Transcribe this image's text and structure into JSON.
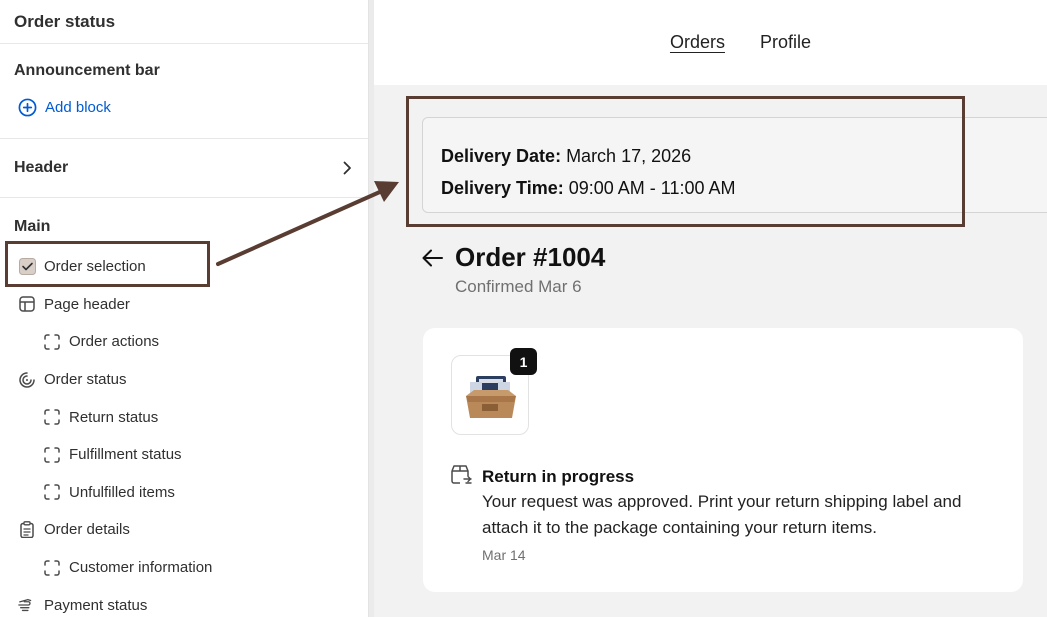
{
  "sidebar": {
    "title": "Order status",
    "announcement": {
      "label": "Announcement bar",
      "add_block": "Add block"
    },
    "header": {
      "label": "Header"
    },
    "main": {
      "label": "Main",
      "items": [
        {
          "label": "Order selection",
          "icon": "checkbox-icon",
          "level": 1
        },
        {
          "label": "Page header",
          "icon": "layout-icon",
          "level": 1
        },
        {
          "label": "Order actions",
          "icon": "block-icon",
          "level": 2
        },
        {
          "label": "Order status",
          "icon": "status-icon",
          "level": 1
        },
        {
          "label": "Return status",
          "icon": "block-icon",
          "level": 2
        },
        {
          "label": "Fulfillment status",
          "icon": "block-icon",
          "level": 2
        },
        {
          "label": "Unfulfilled items",
          "icon": "block-icon",
          "level": 2
        },
        {
          "label": "Order details",
          "icon": "clipboard-icon",
          "level": 1
        },
        {
          "label": "Customer information",
          "icon": "block-icon",
          "level": 2
        },
        {
          "label": "Payment status",
          "icon": "payment-icon",
          "level": 1
        }
      ]
    }
  },
  "preview": {
    "nav": {
      "orders": "Orders",
      "profile": "Profile"
    },
    "delivery": {
      "date_label": "Delivery Date:",
      "date_value": "March 17, 2026",
      "time_label": "Delivery Time:",
      "time_value": "09:00 AM - 11:00 AM"
    },
    "order": {
      "title": "Order #1004",
      "subtitle": "Confirmed Mar 6",
      "item_count": "1",
      "return_title": "Return in progress",
      "return_text": "Your request was approved. Print your return shipping label and attach it to the package containing your return items.",
      "return_date": "Mar 14"
    }
  },
  "colors": {
    "link": "#005bd3",
    "annotation": "#5a3d32"
  }
}
